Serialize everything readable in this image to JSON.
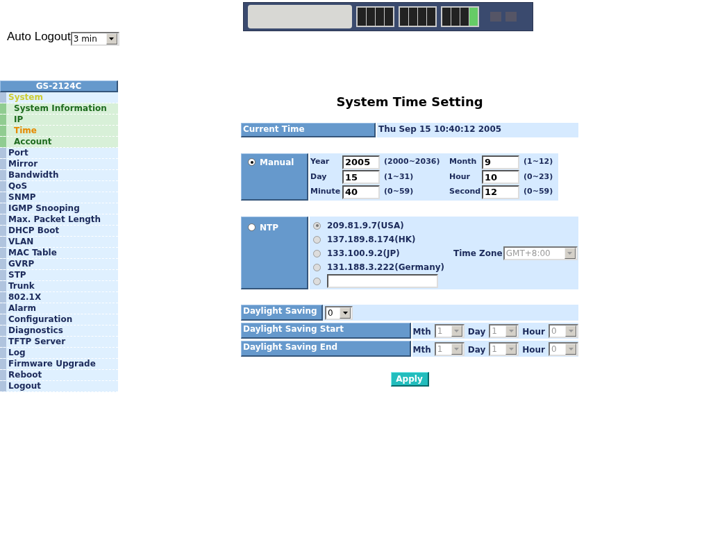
{
  "auto_logout": {
    "label": "Auto Logout",
    "value": "3 min"
  },
  "sidebar": {
    "title": "GS-2124C",
    "items": [
      {
        "label": "System",
        "expanded": true,
        "selected": false,
        "children": [
          {
            "label": "System Information",
            "selected": false
          },
          {
            "label": "IP",
            "selected": false
          },
          {
            "label": "Time",
            "selected": true
          },
          {
            "label": "Account",
            "selected": false
          }
        ]
      },
      {
        "label": "Port",
        "expanded": false,
        "selected": false
      },
      {
        "label": "Mirror",
        "expanded": false,
        "selected": false
      },
      {
        "label": "Bandwidth",
        "expanded": false,
        "selected": false
      },
      {
        "label": "QoS",
        "expanded": false,
        "selected": false
      },
      {
        "label": "SNMP",
        "expanded": false,
        "selected": false
      },
      {
        "label": "IGMP Snooping",
        "expanded": false,
        "selected": false
      },
      {
        "label": "Max. Packet Length",
        "expanded": false,
        "selected": false
      },
      {
        "label": "DHCP Boot",
        "expanded": false,
        "selected": false
      },
      {
        "label": "VLAN",
        "expanded": false,
        "selected": false
      },
      {
        "label": "MAC Table",
        "expanded": false,
        "selected": false
      },
      {
        "label": "GVRP",
        "expanded": false,
        "selected": false
      },
      {
        "label": "STP",
        "expanded": false,
        "selected": false
      },
      {
        "label": "Trunk",
        "expanded": false,
        "selected": false
      },
      {
        "label": "802.1X",
        "expanded": false,
        "selected": false
      },
      {
        "label": "Alarm",
        "expanded": false,
        "selected": false
      },
      {
        "label": "Configuration",
        "expanded": false,
        "selected": false
      },
      {
        "label": "Diagnostics",
        "expanded": false,
        "selected": false
      },
      {
        "label": "TFTP Server",
        "expanded": false,
        "selected": false
      },
      {
        "label": "Log",
        "expanded": false,
        "selected": false
      },
      {
        "label": "Firmware Upgrade",
        "expanded": false,
        "selected": false
      },
      {
        "label": "Reboot",
        "expanded": false,
        "selected": false
      },
      {
        "label": "Logout",
        "expanded": false,
        "selected": false
      }
    ]
  },
  "page_title": "System Time Setting",
  "current_time": {
    "label": "Current Time",
    "value": "Thu Sep 15 10:40:12 2005"
  },
  "manual": {
    "label": "Manual",
    "selected": true,
    "fields": [
      {
        "label": "Year",
        "value": "2005",
        "range": "(2000~2036)"
      },
      {
        "label": "Month",
        "value": "9",
        "range": "(1~12)"
      },
      {
        "label": "Day",
        "value": "15",
        "range": "(1~31)"
      },
      {
        "label": "Hour",
        "value": "10",
        "range": "(0~23)"
      },
      {
        "label": "Minute",
        "value": "40",
        "range": "(0~59)"
      },
      {
        "label": "Second",
        "value": "12",
        "range": "(0~59)"
      }
    ]
  },
  "ntp": {
    "label": "NTP",
    "selected": false,
    "disabled": true,
    "servers": [
      {
        "kind": "preset",
        "label": "209.81.9.7(USA)",
        "selected": true
      },
      {
        "kind": "preset",
        "label": "137.189.8.174(HK)",
        "selected": false
      },
      {
        "kind": "preset",
        "label": "133.100.9.2(JP)",
        "selected": false
      },
      {
        "kind": "preset",
        "label": "131.188.3.222(Germany)",
        "selected": false
      },
      {
        "kind": "custom",
        "selected": false
      }
    ],
    "time_zone": {
      "label": "Time Zone",
      "value": "GMT+8:00"
    }
  },
  "daylight_saving": {
    "label": "Daylight Saving",
    "value": "0",
    "rows": [
      {
        "label": "Daylight Saving Start",
        "disabled": true,
        "fields": [
          {
            "label": "Mth",
            "value": "1"
          },
          {
            "label": "Day",
            "value": "1"
          },
          {
            "label": "Hour",
            "value": "0"
          }
        ]
      },
      {
        "label": "Daylight Saving End",
        "disabled": true,
        "fields": [
          {
            "label": "Mth",
            "value": "1"
          },
          {
            "label": "Day",
            "value": "1"
          },
          {
            "label": "Hour",
            "value": "0"
          }
        ]
      }
    ]
  },
  "apply_button": "Apply"
}
